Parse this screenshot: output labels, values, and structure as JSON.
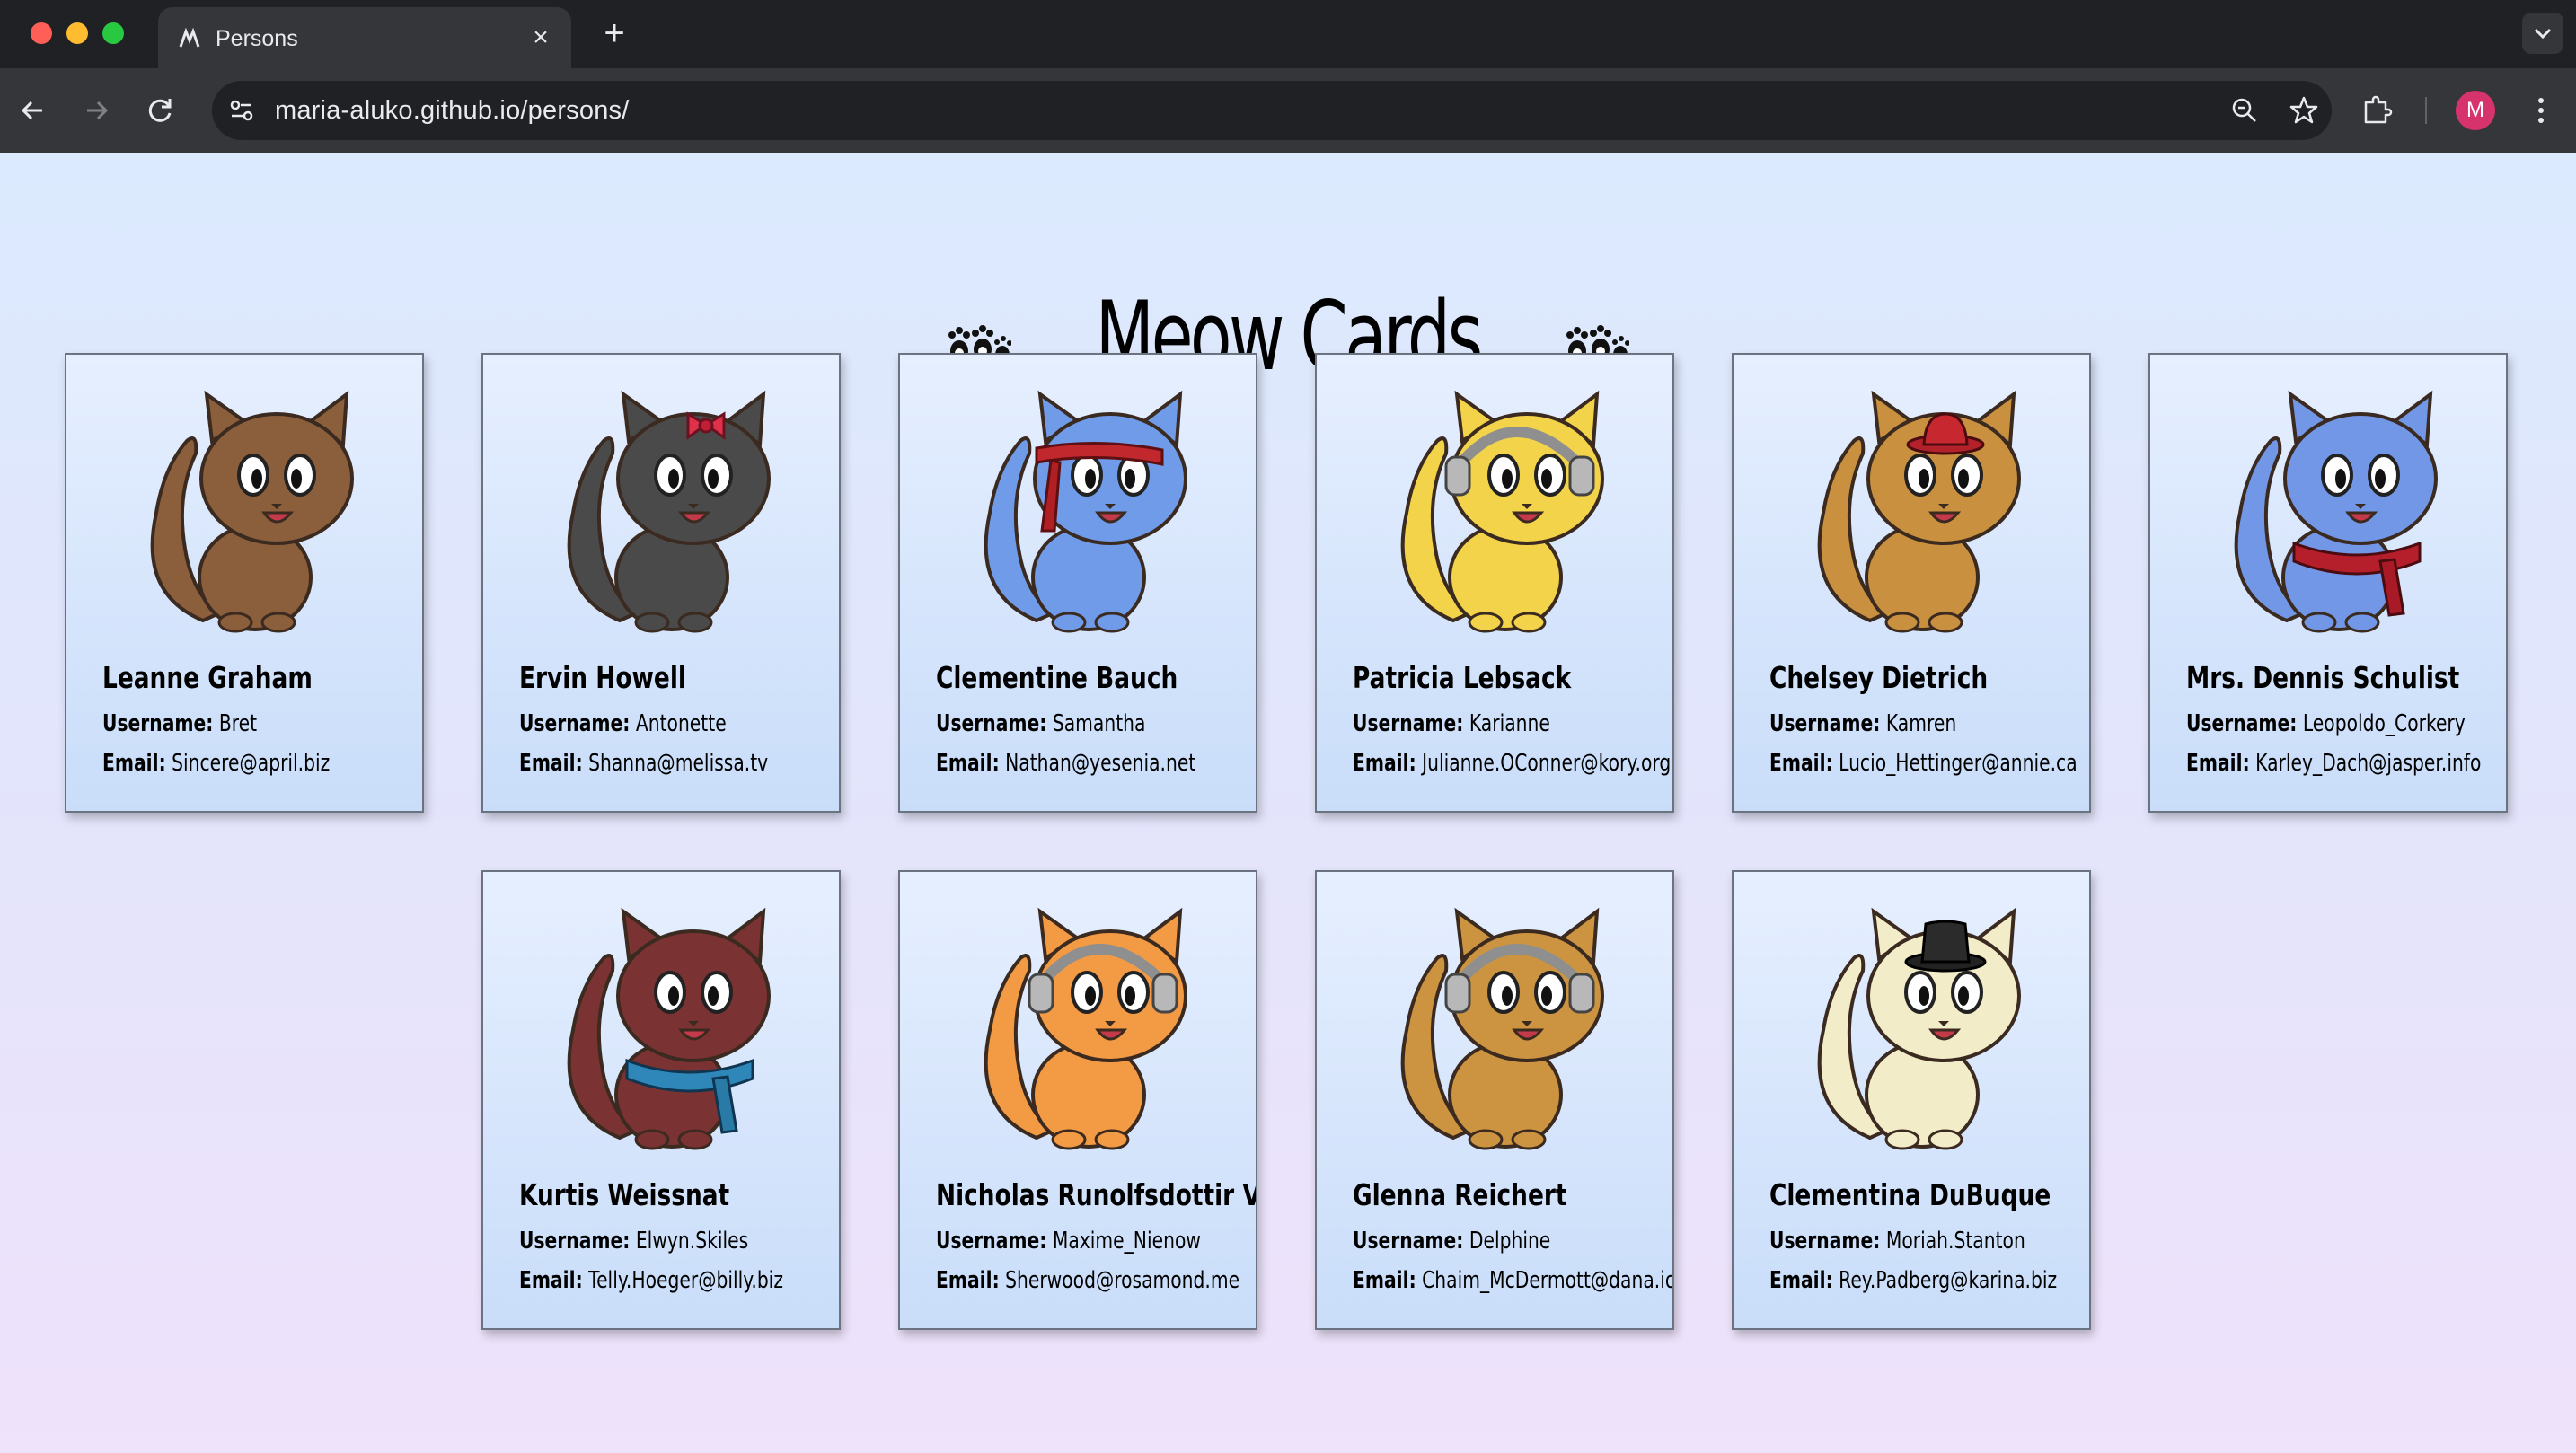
{
  "browser": {
    "tab_title": "Persons",
    "url": "maria-aluko.github.io/persons/",
    "profile_initial": "M"
  },
  "page": {
    "title": "Meow Cards",
    "username_label": "Username:",
    "email_label": "Email:"
  },
  "cards": [
    {
      "name": "Leanne Graham",
      "username": "Bret",
      "email": "Sincere@april.biz",
      "cat_color": "#8b5e3c",
      "accessory": "none"
    },
    {
      "name": "Ervin Howell",
      "username": "Antonette",
      "email": "Shanna@melissa.tv",
      "cat_color": "#4a4a4a",
      "accessory": "bow"
    },
    {
      "name": "Clementine Bauch",
      "username": "Samantha",
      "email": "Nathan@yesenia.net",
      "cat_color": "#6f9be8",
      "accessory": "headband"
    },
    {
      "name": "Patricia Lebsack",
      "username": "Karianne",
      "email": "Julianne.OConner@kory.org",
      "cat_color": "#f3d34a",
      "accessory": "headset"
    },
    {
      "name": "Chelsey Dietrich",
      "username": "Kamren",
      "email": "Lucio_Hettinger@annie.ca",
      "cat_color": "#c9913f",
      "accessory": "hat"
    },
    {
      "name": "Mrs. Dennis Schulist",
      "username": "Leopoldo_Corkery",
      "email": "Karley_Dach@jasper.info",
      "cat_color": "#7297e6",
      "accessory": "scarf"
    },
    {
      "name": "Kurtis Weissnat",
      "username": "Elwyn.Skiles",
      "email": "Telly.Hoeger@billy.biz",
      "cat_color": "#7a3232",
      "accessory": "scarf-blue"
    },
    {
      "name": "Nicholas Runolfsdottir V",
      "username": "Maxime_Nienow",
      "email": "Sherwood@rosamond.me",
      "cat_color": "#f39a45",
      "accessory": "headphones"
    },
    {
      "name": "Glenna Reichert",
      "username": "Delphine",
      "email": "Chaim_McDermott@dana.io",
      "cat_color": "#cc9440",
      "accessory": "headset"
    },
    {
      "name": "Clementina DuBuque",
      "username": "Moriah.Stanton",
      "email": "Rey.Padberg@karina.biz",
      "cat_color": "#f3ecc8",
      "accessory": "top-hat"
    }
  ]
}
